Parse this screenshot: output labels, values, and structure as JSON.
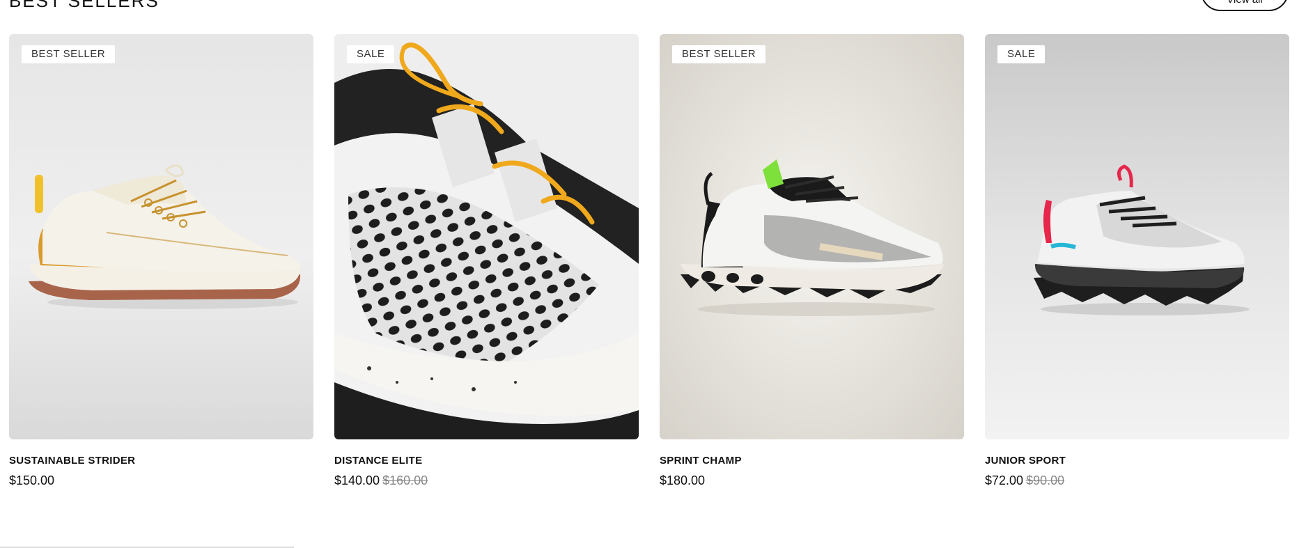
{
  "section": {
    "title": "BEST SELLERS",
    "view_all_label": "View all"
  },
  "products": [
    {
      "name": "SUSTAINABLE STRIDER",
      "price": "$150.00",
      "compare_price": "",
      "badge": "BEST SELLER",
      "image": "cream-sneaker-image",
      "accent": "#d99a2b"
    },
    {
      "name": "DISTANCE ELITE",
      "price": "$140.00",
      "compare_price": "$160.00",
      "badge": "SALE",
      "image": "mesh-closeup-image",
      "accent": "#f0a81c"
    },
    {
      "name": "SPRINT CHAMP",
      "price": "$180.00",
      "compare_price": "",
      "badge": "BEST SELLER",
      "image": "trail-sneaker-image",
      "accent": "#7ee03a"
    },
    {
      "name": "JUNIOR SPORT",
      "price": "$72.00",
      "compare_price": "$90.00",
      "badge": "SALE",
      "image": "kids-sneaker-image",
      "accent": "#e6264a"
    }
  ]
}
